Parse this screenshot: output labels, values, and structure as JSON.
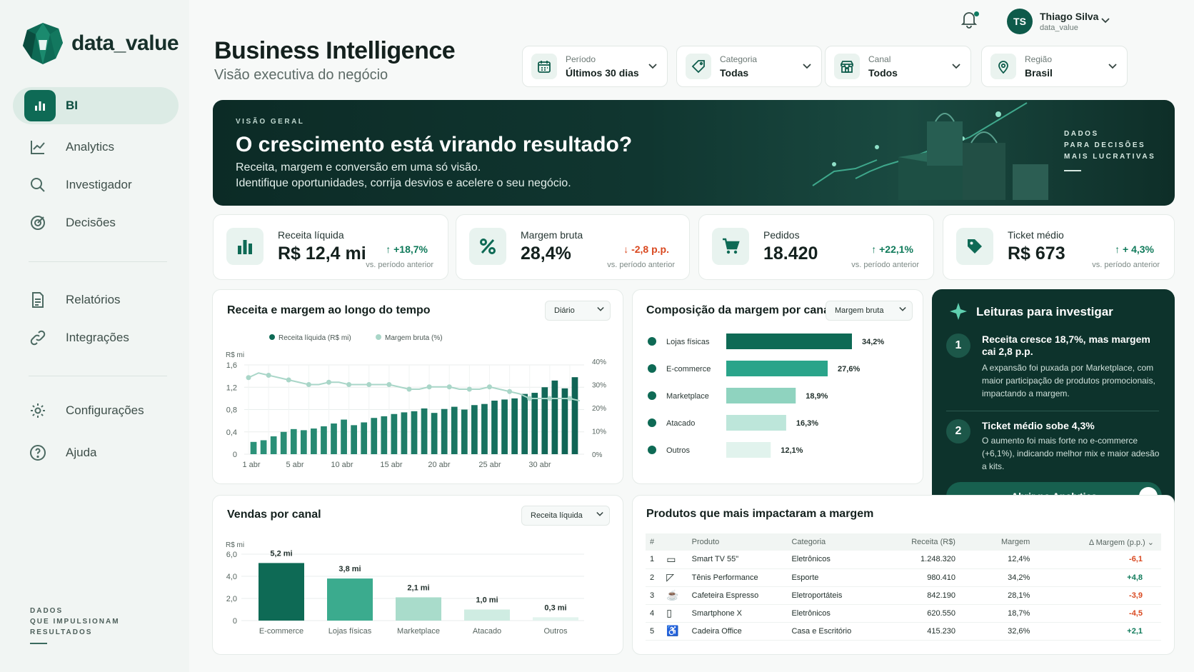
{
  "app": {
    "brand": "data_value"
  },
  "sidebar": {
    "items": [
      {
        "label": "BI",
        "icon": "bar-chart-icon",
        "active": true
      },
      {
        "label": "Analytics",
        "icon": "trend-line-icon"
      },
      {
        "label": "Investigador",
        "icon": "search-icon"
      },
      {
        "label": "Decisões",
        "icon": "target-icon"
      },
      {
        "label": "Relatórios",
        "icon": "document-icon"
      },
      {
        "label": "Integrações",
        "icon": "link-icon"
      },
      {
        "label": "Configurações",
        "icon": "gear-icon"
      },
      {
        "label": "Ajuda",
        "icon": "help-icon"
      }
    ],
    "footer_lines": [
      "DADOS",
      "QUE IMPULSIONAM",
      "RESULTADOS"
    ]
  },
  "header": {
    "title": "Business Intelligence",
    "subtitle": "Visão executiva do negócio",
    "filters": [
      {
        "label": "Período",
        "value": "Últimos 30 dias",
        "icon": "calendar-icon"
      },
      {
        "label": "Categoria",
        "value": "Todas",
        "icon": "tag-icon"
      },
      {
        "label": "Canal",
        "value": "Todos",
        "icon": "store-icon"
      },
      {
        "label": "Região",
        "value": "Brasil",
        "icon": "location-pin-icon"
      }
    ],
    "user": {
      "initials": "TS",
      "name": "Thiago Silva",
      "org": "data_value"
    }
  },
  "hero": {
    "kicker": "VISÃO GERAL",
    "title": "O crescimento está virando resultado?",
    "line1": "Receita, margem e conversão em uma só visão.",
    "line2": "Identifique oportunidades, corrija desvios e acelere o seu negócio.",
    "right_lines": [
      "DADOS",
      "PARA DECISÕES",
      "MAIS LUCRATIVAS"
    ]
  },
  "kpis": [
    {
      "label": "Receita líquida",
      "value": "R$ 12,4 mi",
      "delta": "+18,7%",
      "direction": "up",
      "sub": "vs. período anterior",
      "icon": "bar-chart-icon"
    },
    {
      "label": "Margem bruta",
      "value": "28,4%",
      "delta": "-2,8 p.p.",
      "direction": "down",
      "sub": "vs. período anterior",
      "icon": "percent-icon"
    },
    {
      "label": "Pedidos",
      "value": "18.420",
      "delta": "+22,1%",
      "direction": "up",
      "sub": "vs. período anterior",
      "icon": "cart-icon"
    },
    {
      "label": "Ticket médio",
      "value": "R$ 673",
      "delta": "+ 4,3%",
      "direction": "up",
      "sub": "vs. período anterior",
      "icon": "price-tag-icon"
    }
  ],
  "colors": {
    "primary": "#0e6a55",
    "up": "#0f7a5a",
    "down": "#d9481f",
    "line": "#a9d6c8"
  },
  "revenue_chart": {
    "title": "Receita e margem ao longo do tempo",
    "dropdown": "Diário",
    "legend": [
      "Receita líquida (R$ mi)",
      "Margem bruta (%)"
    ]
  },
  "channel_margin": {
    "title": "Composição da margem por canal",
    "dropdown": "Margem bruta"
  },
  "sales_channel": {
    "title": "Vendas por canal",
    "dropdown": "Receita líquida"
  },
  "chart_data": [
    {
      "type": "bar",
      "title": "Receita e margem ao longo do tempo",
      "ylabel": "R$ mi",
      "ylim": [
        0,
        1.6
      ],
      "y_ticks": [
        "0",
        "0,4",
        "0,8",
        "1,2",
        "1,6"
      ],
      "y2lim": [
        0,
        40
      ],
      "y2_ticks": [
        "0%",
        "10%",
        "20%",
        "30%",
        "40%"
      ],
      "x_ticks": [
        "1 abr",
        "5 abr",
        "10 abr",
        "15 abr",
        "20 abr",
        "25 abr",
        "30 abr"
      ],
      "grid": true,
      "legend_position": "top",
      "series": [
        {
          "name": "Receita líquida (R$ mi)",
          "kind": "bar",
          "values": [
            0.22,
            0.25,
            0.32,
            0.4,
            0.45,
            0.43,
            0.46,
            0.5,
            0.55,
            0.62,
            0.52,
            0.57,
            0.65,
            0.68,
            0.72,
            0.75,
            0.77,
            0.82,
            0.74,
            0.81,
            0.85,
            0.8,
            0.88,
            0.9,
            0.96,
            0.98,
            1.0,
            1.08,
            1.1,
            1.2,
            1.32,
            1.18,
            1.38
          ]
        },
        {
          "name": "Margem bruta (%)",
          "kind": "line",
          "values": [
            33,
            35,
            34,
            33,
            32,
            31,
            30,
            30,
            31,
            31,
            30,
            30,
            30,
            30,
            30,
            29,
            28,
            28,
            29,
            29,
            29,
            28,
            28,
            28,
            29,
            28,
            27,
            26,
            24,
            24,
            24,
            24,
            24,
            23
          ]
        }
      ]
    },
    {
      "type": "bar",
      "title": "Composição da margem por canal",
      "orientation": "horizontal",
      "categories": [
        "Lojas físicas",
        "E-commerce",
        "Marketplace",
        "Atacado",
        "Outros"
      ],
      "values": [
        34.2,
        27.6,
        18.9,
        16.3,
        12.1
      ],
      "labels": [
        "34,2%",
        "27,6%",
        "18,9%",
        "16,3%",
        "12,1%"
      ],
      "icons": [
        "store-icon",
        "cart-icon",
        "bag-icon",
        "cart-icon",
        "circle-icon"
      ]
    },
    {
      "type": "bar",
      "title": "Vendas por canal",
      "ylabel": "R$ mi",
      "ylim": [
        0,
        6
      ],
      "y_ticks": [
        "0",
        "2,0",
        "4,0",
        "6,0"
      ],
      "categories": [
        "E-commerce",
        "Lojas físicas",
        "Marketplace",
        "Atacado",
        "Outros"
      ],
      "values": [
        5.2,
        3.8,
        2.1,
        1.0,
        0.3
      ],
      "labels": [
        "5,2 mi",
        "3,8 mi",
        "2,1 mi",
        "1,0 mi",
        "0,3 mi"
      ]
    }
  ],
  "insights": {
    "title": "Leituras para investigar",
    "items": [
      {
        "n": "1",
        "heading": "Receita cresce 18,7%, mas margem cai 2,8 p.p.",
        "text": "A expansão foi puxada por Marketplace, com maior participação de produtos promocionais, impactando a margem."
      },
      {
        "n": "2",
        "heading": "Ticket médio sobe 4,3%",
        "text": "O aumento foi mais forte no e-commerce (+6,1%), indicando melhor mix e maior adesão a kits."
      }
    ],
    "button": "Abrir no Analytics"
  },
  "products": {
    "title": "Produtos que mais impactaram a margem",
    "headers": [
      "#",
      "Produto",
      "Categoria",
      "Receita (R$)",
      "Margem",
      "Δ Margem (p.p.)"
    ],
    "rows": [
      {
        "n": "1",
        "icon": "tv-icon",
        "product": "Smart TV 55\"",
        "category": "Eletrônicos",
        "revenue": "1.248.320",
        "margin": "12,4%",
        "delta": "-6,1",
        "dir": "down"
      },
      {
        "n": "2",
        "icon": "sneaker-icon",
        "product": "Tênis Performance",
        "category": "Esporte",
        "revenue": "980.410",
        "margin": "34,2%",
        "delta": "+4,8",
        "dir": "up"
      },
      {
        "n": "3",
        "icon": "coffee-maker-icon",
        "product": "Cafeteira Espresso",
        "category": "Eletroportáteis",
        "revenue": "842.190",
        "margin": "28,1%",
        "delta": "-3,9",
        "dir": "down"
      },
      {
        "n": "4",
        "icon": "smartphone-icon",
        "product": "Smartphone X",
        "category": "Eletrônicos",
        "revenue": "620.550",
        "margin": "18,7%",
        "delta": "-4,5",
        "dir": "down"
      },
      {
        "n": "5",
        "icon": "office-chair-icon",
        "product": "Cadeira Office",
        "category": "Casa e Escritório",
        "revenue": "415.230",
        "margin": "32,6%",
        "delta": "+2,1",
        "dir": "up"
      }
    ]
  }
}
